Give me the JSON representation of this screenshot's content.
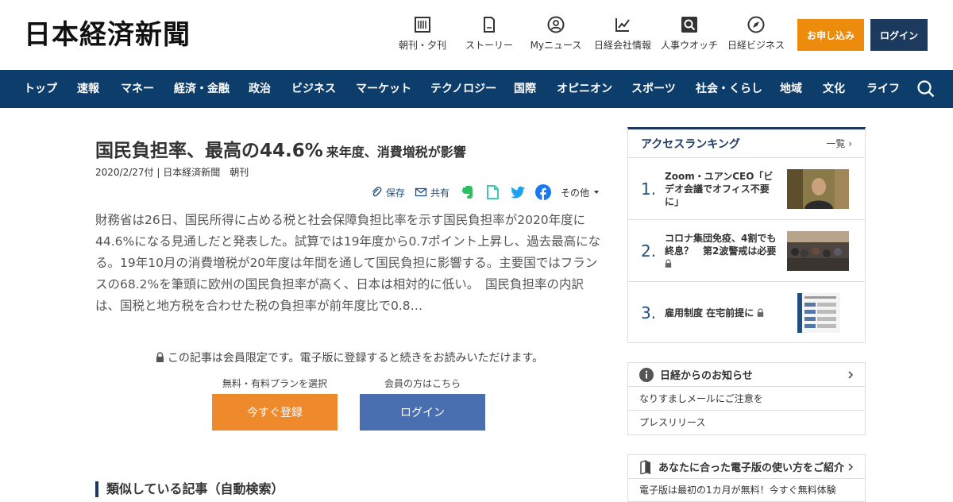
{
  "header": {
    "logo": "日本経済新聞",
    "tools": [
      {
        "label": "朝刊・夕刊",
        "icon": "newspaper-icon"
      },
      {
        "label": "ストーリー",
        "icon": "document-icon"
      },
      {
        "label": "Myニュース",
        "icon": "user-icon"
      },
      {
        "label": "日経会社情報",
        "icon": "chart-icon"
      },
      {
        "label": "人事ウオッチ",
        "icon": "search-person-icon"
      },
      {
        "label": "日経ビジネス",
        "icon": "compass-icon"
      }
    ],
    "apply_label": "お申し込み",
    "login_label": "ログイン"
  },
  "nav": {
    "items": [
      "トップ",
      "速報",
      "マネー",
      "経済・金融",
      "政治",
      "ビジネス",
      "マーケット",
      "テクノロジー",
      "国際",
      "オピニオン",
      "スポーツ",
      "社会・くらし",
      "地域",
      "文化",
      "ライフ"
    ]
  },
  "article": {
    "title": "国民負担率、最高の44.6%",
    "subtitle": "来年度、消費増税が影響",
    "meta": "2020/2/27付 | 日本経済新聞　朝刊",
    "actions": {
      "save": "保存",
      "share": "共有",
      "more": "その他"
    },
    "body": "財務省は26日、国民所得に占める税と社会保障負担比率を示す国民負担率が2020年度に44.6%になる見通しだと発表した。試算では19年度から0.7ポイント上昇し、過去最高になる。19年10月の消費増税が20年度は年間を通して国民負担に影響する。主要国ではフランスの68.2%を筆頭に欧州の国民負担率が高く、日本は相対的に低い。　国民負担率の内訳は、国税と地方税を合わせた税の負担率が前年度比で0.8…",
    "locked_note": "この記事は会員限定です。電子版に登録すると続きをお読みいただけます。",
    "cta_register_caption": "無料・有料プランを選択",
    "cta_register": "今すぐ登録",
    "cta_login_caption": "会員の方はこちら",
    "cta_login": "ログイン",
    "related_heading": "類似している記事（自動検索）"
  },
  "sidebar": {
    "ranking_title": "アクセスランキング",
    "ranking_all": "一覧",
    "ranking": [
      {
        "no": "1.",
        "text": "Zoom・ユアンCEO「ビデオ会議でオフィス不要に」",
        "locked": false
      },
      {
        "no": "2.",
        "text": "コロナ集団免疫、4割でも終息？　第2波警戒は必要",
        "locked": true
      },
      {
        "no": "3.",
        "text": "雇用制度 在宅前提に",
        "locked": true
      }
    ],
    "notice_title": "日経からのお知らせ",
    "notices": [
      "なりすましメールにご注意を",
      "プレスリリース"
    ],
    "guide_title": "あなたに合った電子版の使い方をご紹介",
    "guide_row": "電子版は最初の1カ月が無料！今すぐ無料体験"
  },
  "colors": {
    "nav_bg": "#0d3d6b",
    "apply_btn": "#ec8b0c",
    "login_btn": "#1b3a5e",
    "cta_register": "#ee8a2b",
    "cta_login": "#4a6fb0"
  }
}
